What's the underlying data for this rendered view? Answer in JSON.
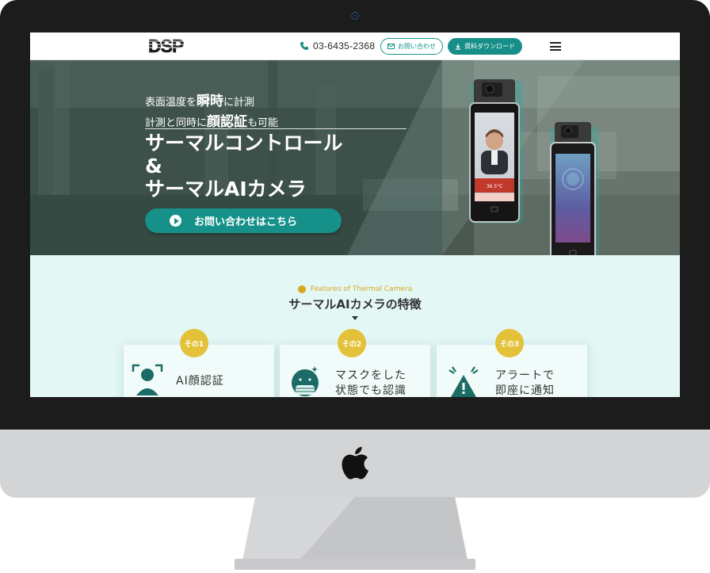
{
  "header": {
    "logo_text": "DSP",
    "phone": "03-6435-2368",
    "contact_label": "お問い合わせ",
    "download_label": "資料ダウンロード",
    "menu_icon": "hamburger-menu-icon"
  },
  "hero": {
    "line1_pre": "表面温度を",
    "line1_bold": "瞬時",
    "line1_post": "に計測",
    "line2_pre": "計測と同時に",
    "line2_bold": "顔認証",
    "line2_post": "も可能",
    "title_line1": "サーマルコントロール",
    "title_line2": "&",
    "title_line3": "サーマルAIカメラ",
    "cta_label": "お問い合わせはこちら",
    "device_readout": "36.5°C"
  },
  "features": {
    "subtitle": "Features of Thermal Camera",
    "title": "サーマルAIカメラの特徴",
    "cards": [
      {
        "badge": "その1",
        "text_line1": "AI顔認証",
        "text_line2": "",
        "icon": "face-recognition-icon"
      },
      {
        "badge": "その2",
        "text_line1": "マスクをした",
        "text_line2": "状態でも認識",
        "icon": "mask-face-icon"
      },
      {
        "badge": "その3",
        "text_line1": "アラートで",
        "text_line2": "即座に通知",
        "icon": "alert-icon"
      }
    ]
  },
  "colors": {
    "accent": "#16958d",
    "badge": "#e3c23a",
    "feature_bg": "#e3f7f5",
    "bezel": "#1c1c1c"
  }
}
